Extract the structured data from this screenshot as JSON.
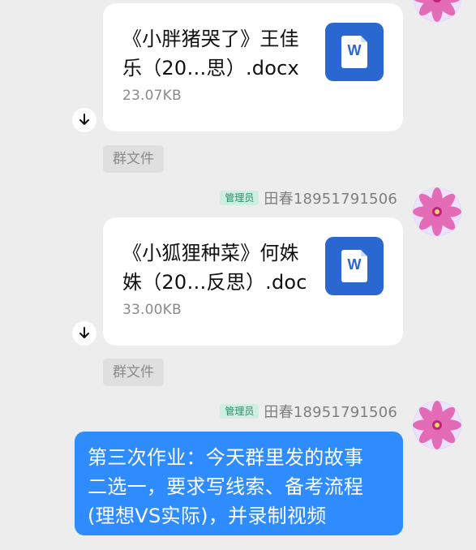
{
  "colors": {
    "background": "#ededed",
    "card": "#ffffff",
    "word_blue": "#2b67d1",
    "bubble_blue": "#2f8cff",
    "role_bg": "#cfeee2",
    "role_text": "#2a8e64",
    "muted_text": "#8a8a8a"
  },
  "messages": [
    {
      "file": {
        "name_line1": "《小胖猪哭了》王佳",
        "name_line2": "乐（20…思）.docx",
        "size": "23.07KB",
        "icon": "word-doc-icon",
        "icon_letter": "W"
      },
      "tag": "群文件",
      "avatar_icon": "flower-avatar-icon"
    },
    {
      "sender": {
        "role": "管理员",
        "name": "田春18951791506"
      },
      "file": {
        "name_line1": "《小狐狸种菜》何姝",
        "name_line2": "姝（20…反思）.doc",
        "size": "33.00KB",
        "icon": "word-doc-icon",
        "icon_letter": "W"
      },
      "tag": "群文件",
      "avatar_icon": "flower-avatar-icon"
    },
    {
      "sender": {
        "role": "管理员",
        "name": "田春18951791506"
      },
      "text_lines": [
        "第三次作业：今天群里发的故事",
        "二选一，要求写线索、备考流程",
        "(理想VS实际)，并录制视频"
      ],
      "avatar_icon": "flower-avatar-icon"
    }
  ]
}
